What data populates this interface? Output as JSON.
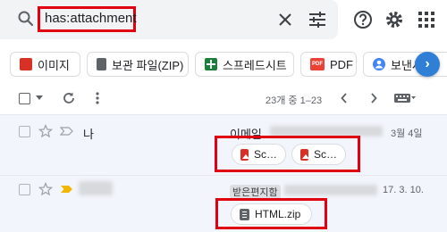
{
  "search": {
    "query": "has:attachment"
  },
  "chips": [
    {
      "label": "이미지",
      "icon": "image-icon",
      "color": "#d93025"
    },
    {
      "label": "보관 파일(ZIP)",
      "icon": "archive-icon",
      "color": "#5f6368"
    },
    {
      "label": "스프레드시트",
      "icon": "sheets-icon",
      "color": "#188038"
    },
    {
      "label": "PDF",
      "icon": "pdf-icon",
      "color": "#ea4335",
      "icon_text": "PDF"
    },
    {
      "label": "보낸사",
      "icon": "person-icon",
      "color": "#4285f4"
    }
  ],
  "toolbar": {
    "range": "23개 중 1–23"
  },
  "rows": [
    {
      "sender": "나",
      "subject": "이메일",
      "date": "3월 4일",
      "attachments": [
        {
          "name": "Sc…",
          "icon": "image-icon"
        },
        {
          "name": "Sc…",
          "icon": "image-icon"
        }
      ]
    },
    {
      "sender": "",
      "label": "받은편지함",
      "date": "17. 3. 10.",
      "attachments": [
        {
          "name": "HTML.zip",
          "icon": "archive-icon"
        }
      ]
    }
  ],
  "colors": {
    "highlight": "#e0000f",
    "row_bg": "#f2f6fc",
    "important": "#f2b600",
    "next_button": "#2f7fd6"
  }
}
